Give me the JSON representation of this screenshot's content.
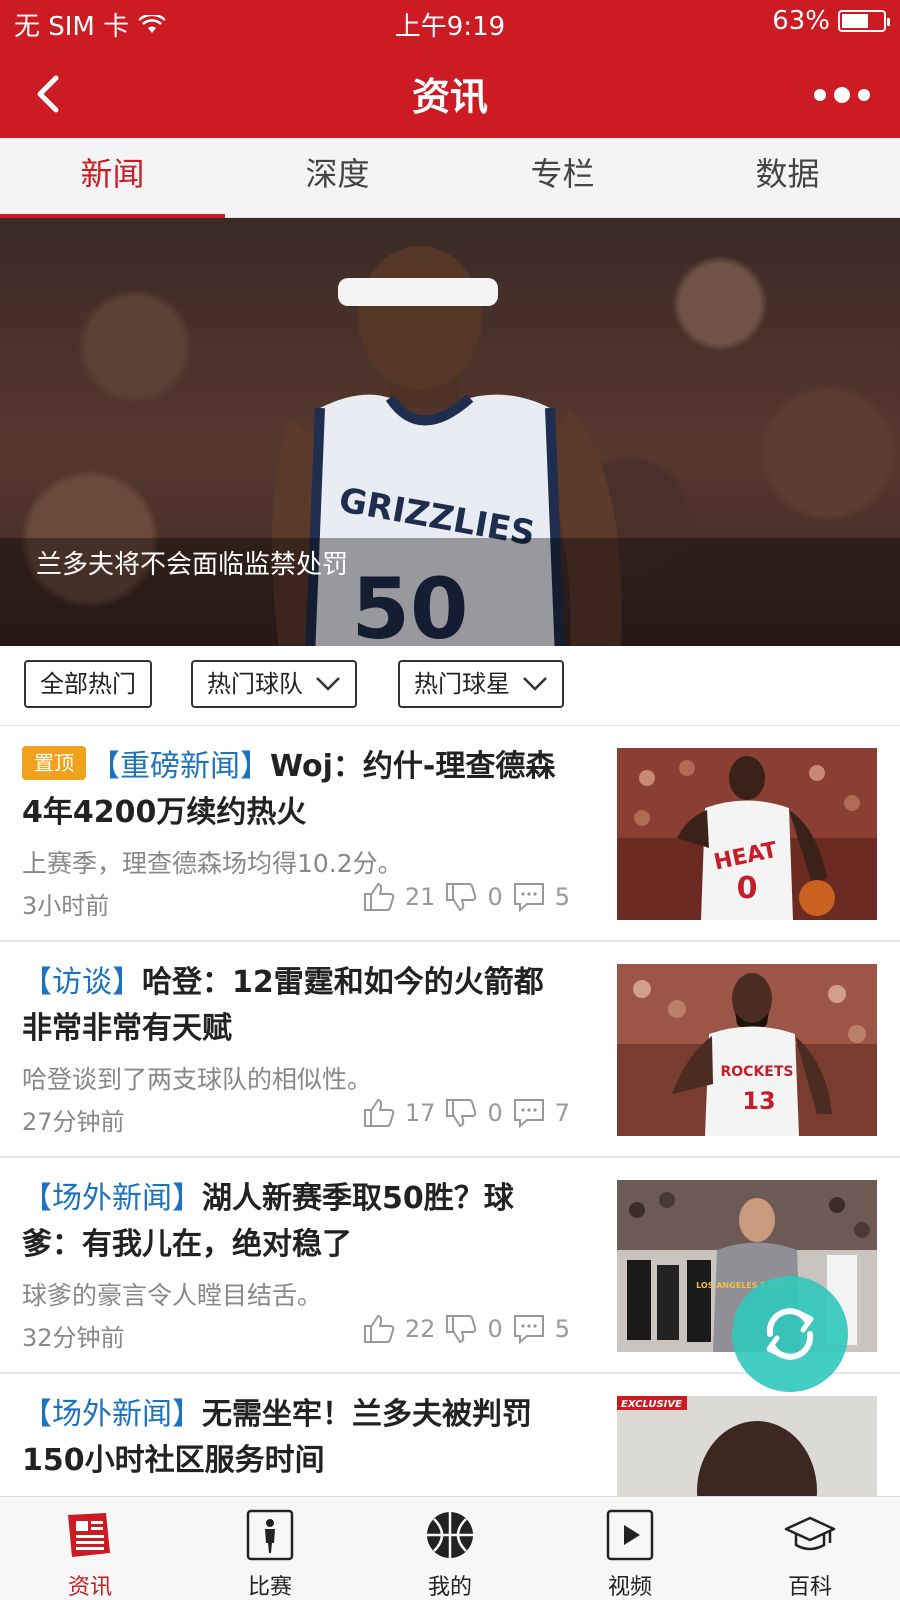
{
  "status": {
    "carrier": "无 SIM 卡",
    "time": "上午9:19",
    "battery": "63%"
  },
  "header": {
    "title": "资讯"
  },
  "tabs": [
    {
      "label": "新闻",
      "active": true
    },
    {
      "label": "深度",
      "active": false
    },
    {
      "label": "专栏",
      "active": false
    },
    {
      "label": "数据",
      "active": false
    }
  ],
  "banner": {
    "caption": "兰多夫将不会面临监禁处罚",
    "jersey_text": "GRIZZLIES",
    "jersey_number": "50",
    "slide_count": 4,
    "active_slide": 4
  },
  "filters": {
    "all": "全部热门",
    "teams": "热门球队",
    "stars": "热门球星"
  },
  "news": [
    {
      "pin": "置顶",
      "category": "【重磅新闻】",
      "title": "Woj：约什-理查德森4年4200万续约热火",
      "summary": "上赛季，理查德森场均得10.2分。",
      "time": "3小时前",
      "likes": "21",
      "dislikes": "0",
      "comments": "5",
      "thumb_jersey": "HEAT",
      "thumb_number": "0"
    },
    {
      "pin": "",
      "category": "【访谈】",
      "title": "哈登：12雷霆和如今的火箭都非常非常有天赋",
      "summary": "哈登谈到了两支球队的相似性。",
      "time": "27分钟前",
      "likes": "17",
      "dislikes": "0",
      "comments": "7",
      "thumb_jersey": "ROCKETS",
      "thumb_number": "13"
    },
    {
      "pin": "",
      "category": "【场外新闻】",
      "title": "湖人新赛季取50胜？球爹：有我儿在，绝对稳了",
      "summary": "球爹的豪言令人瞠目结舌。",
      "time": "32分钟前",
      "likes": "22",
      "dislikes": "0",
      "comments": "5",
      "thumb_jersey": "LOS ANGELES BASKETBALL",
      "thumb_number": ""
    },
    {
      "pin": "",
      "category": "【场外新闻】",
      "title": "无需坐牢！兰多夫被判罚150小时社区服务时间",
      "summary": "",
      "time": "",
      "likes": "",
      "dislikes": "",
      "comments": "",
      "thumb_badge": "EXCLUSIVE"
    }
  ],
  "bottom_nav": [
    {
      "label": "资讯",
      "icon": "newspaper-icon",
      "active": true
    },
    {
      "label": "比赛",
      "icon": "player-card-icon",
      "active": false
    },
    {
      "label": "我的",
      "icon": "basketball-icon",
      "active": false
    },
    {
      "label": "视频",
      "icon": "play-icon",
      "active": false
    },
    {
      "label": "百科",
      "icon": "graduation-cap-icon",
      "active": false
    }
  ],
  "colors": {
    "brand_red": "#cc1b22",
    "category_blue": "#1e73be",
    "pin_orange": "#f0a21c",
    "fab_teal": "#30c8be"
  }
}
